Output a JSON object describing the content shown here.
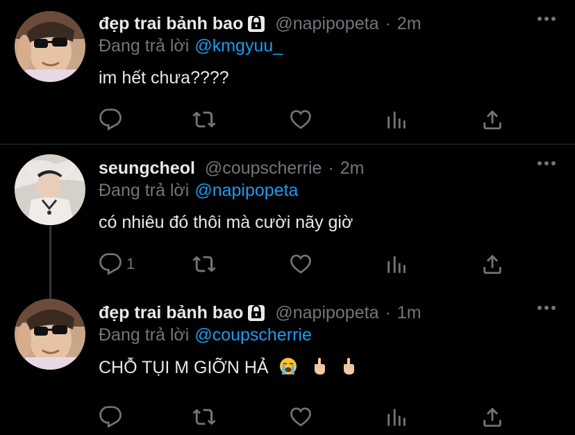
{
  "tweets": [
    {
      "author_name": "đẹp trai bảnh bao",
      "locked": true,
      "handle": "@napipopeta",
      "separator": "·",
      "time": "2m",
      "reply_prefix": "Đang trả lời",
      "reply_to": "@kmgyuu_",
      "text": "im hết chưa????",
      "reply_count": "",
      "avatar": "avatar-sunglasses-boy"
    },
    {
      "author_name": "seungcheol",
      "locked": false,
      "handle": "@coupscherrie",
      "separator": "·",
      "time": "2m",
      "reply_prefix": "Đang trả lời",
      "reply_to": "@napipopeta",
      "text": "có nhiêu đó thôi mà cười nãy giờ",
      "reply_count": "1",
      "avatar": "avatar-arms-up-guy"
    },
    {
      "author_name": "đẹp trai bảnh bao",
      "locked": true,
      "handle": "@napipopeta",
      "separator": "·",
      "time": "1m",
      "reply_prefix": "Đang trả lời",
      "reply_to": "@coupscherrie",
      "text": "CHỖ TỤI M GIỠN HẢ",
      "reply_count": "",
      "avatar": "avatar-sunglasses-boy",
      "emojis": [
        "loudly-crying-face",
        "middle-finger",
        "middle-finger"
      ]
    }
  ],
  "colors": {
    "background": "#000000",
    "primary_text": "#e7e9ea",
    "secondary_text": "#71767b",
    "accent": "#1d9bf0",
    "divider": "#2f3336"
  },
  "icons": [
    "reply-icon",
    "retweet-icon",
    "like-icon",
    "analytics-icon",
    "share-icon",
    "more-icon",
    "lock-icon"
  ]
}
